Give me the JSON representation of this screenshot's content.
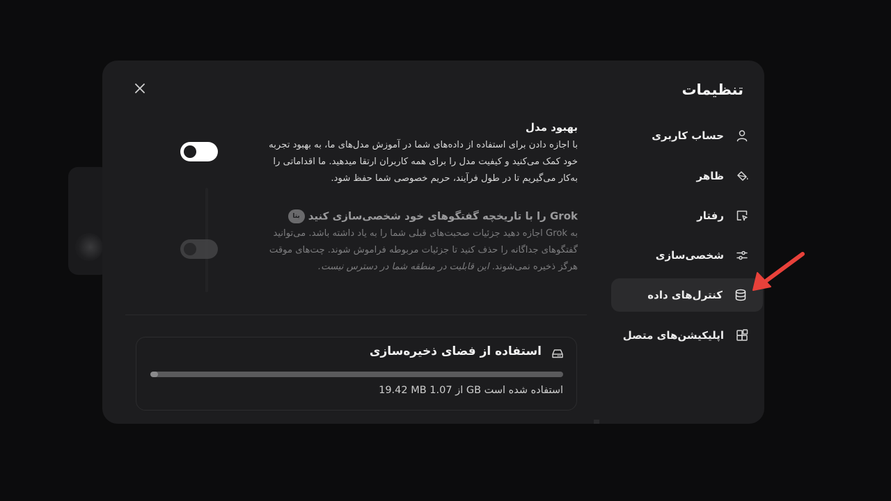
{
  "modal": {
    "title": "تنظیمات",
    "close_icon": "close-icon"
  },
  "sidebar": {
    "items": [
      {
        "label": "حساب کاربری",
        "icon": "user-icon",
        "active": false
      },
      {
        "label": "ظاهر",
        "icon": "paint-bucket-icon",
        "active": false
      },
      {
        "label": "رفتار",
        "icon": "cursor-window-icon",
        "active": false
      },
      {
        "label": "شخصی‌سازی",
        "icon": "sliders-icon",
        "active": false
      },
      {
        "label": "کنترل‌های داده",
        "icon": "database-icon",
        "active": true
      },
      {
        "label": "اپلیکیشن‌های متصل",
        "icon": "apps-grid-icon",
        "active": false
      }
    ]
  },
  "model_improvement": {
    "title": "بهبود مدل",
    "description": "با اجازه دادن برای استفاده از داده‌های شما در آموزش مدل‌های ما، به بهبود تجربه خود کمک می‌کنید و کیفیت مدل را برای همه کاربران ارتقا میدهید. ما اقداماتی را به‌کار می‌گیریم تا در طول فرآیند، حریم خصوصی شما حفظ شود.",
    "enabled": false
  },
  "personalize_history": {
    "title": "Grok را با تاریخچه گفتگوهای خود شخصی‌سازی کنید",
    "badge": "بتا",
    "description_normal": "به Grok اجازه دهید جزئیات صحبت‌های قبلی شما را به یاد داشته باشد. می‌توانید گفتگوهای جداگانه را حذف کنید تا جزئیات مربوطه فراموش شوند. چت‌های موقت هرگز ذخیره نمی‌شوند.",
    "description_italic": "این قابلیت در منطقه شما در دسترس نیست.",
    "disabled": true
  },
  "storage": {
    "title": "استفاده از فضای ذخیره‌سازی",
    "icon": "hard-drive-icon",
    "usage_text": "19.42 MB از 1.07 GB استفاده شده است",
    "used_fraction": 0.018
  },
  "annotation": {
    "arrow_color": "#e8413a"
  }
}
